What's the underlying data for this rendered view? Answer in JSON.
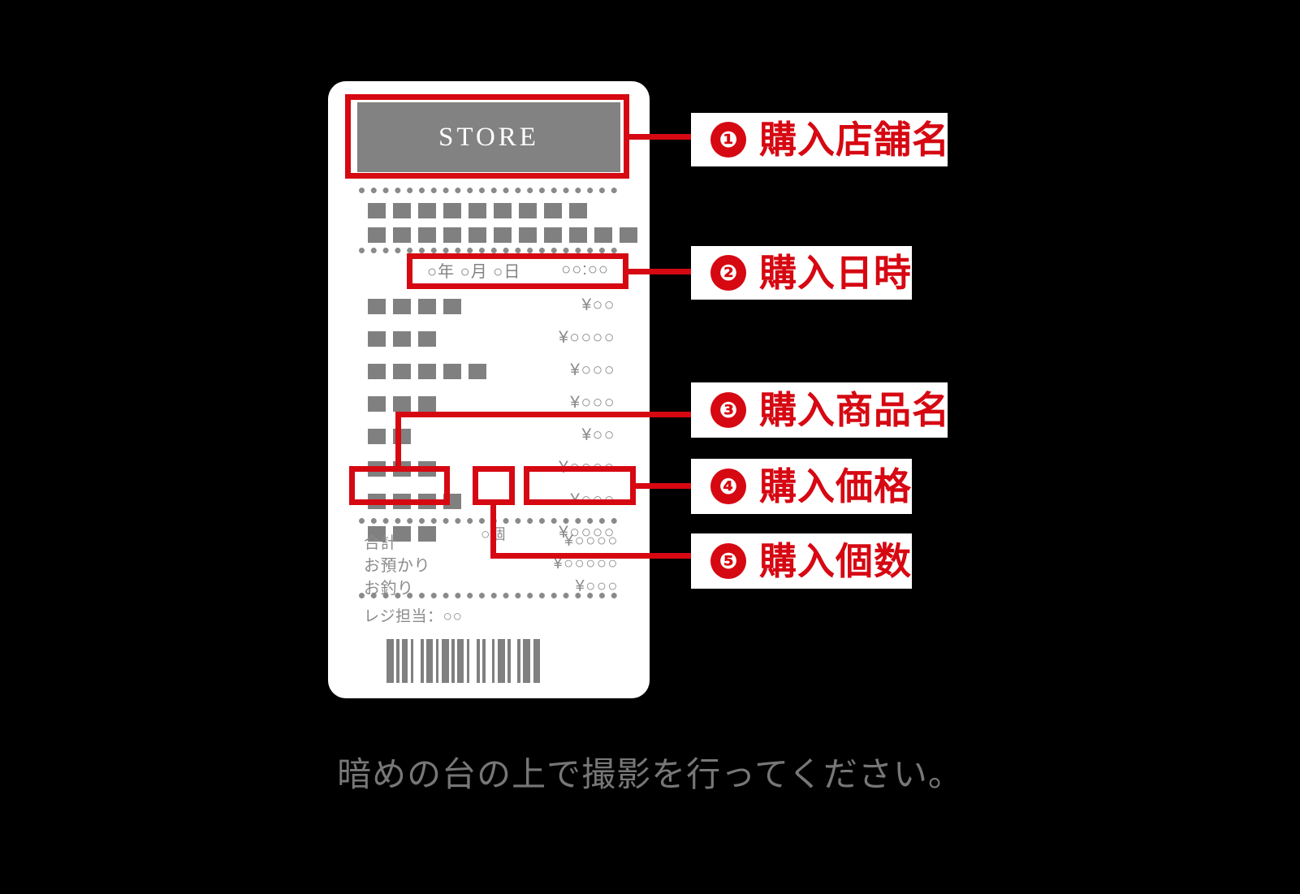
{
  "background_color": "#000000",
  "accent_color": "#d60812",
  "receipt": {
    "store_name": "STORE",
    "date_line": {
      "date": "○年 ○月 ○日",
      "time": "○○:○○"
    },
    "header_block_rows": [
      9,
      11
    ],
    "items": [
      {
        "name_blocks": 4,
        "price": "¥○○"
      },
      {
        "name_blocks": 3,
        "price": "¥○○○○"
      },
      {
        "name_blocks": 5,
        "price": "¥○○○"
      },
      {
        "name_blocks": 3,
        "price": "¥○○○"
      },
      {
        "name_blocks": 2,
        "price": "¥○○"
      },
      {
        "name_blocks": 3,
        "price": "¥○○○○"
      },
      {
        "name_blocks": 4,
        "price": "¥○○○"
      },
      {
        "name_blocks": 3,
        "price": "¥○○○○"
      }
    ],
    "highlighted_item": {
      "quantity": "○個",
      "price": "¥○○○○"
    },
    "totals": [
      {
        "label": "合計",
        "value": "¥○○○○"
      },
      {
        "label": "お預かり",
        "value": "¥○○○○○"
      },
      {
        "label": "お釣り",
        "value": "¥○○○"
      }
    ],
    "clerk": "レジ担当：○○",
    "barcode_widths": [
      9,
      3,
      4,
      3,
      7,
      4,
      3,
      9,
      4,
      3,
      8,
      4,
      3,
      4,
      9,
      3,
      4,
      3,
      8,
      4,
      3,
      9,
      4,
      3,
      4,
      8,
      3,
      4,
      9,
      3,
      4,
      8,
      4,
      3,
      9,
      4,
      8
    ]
  },
  "annotations": [
    {
      "number": "❶",
      "text": "購入店舗名"
    },
    {
      "number": "❷",
      "text": "購入日時"
    },
    {
      "number": "❸",
      "text": "購入商品名"
    },
    {
      "number": "❹",
      "text": "購入価格"
    },
    {
      "number": "❺",
      "text": "購入個数"
    }
  ],
  "caption": "暗めの台の上で撮影を行ってください。"
}
